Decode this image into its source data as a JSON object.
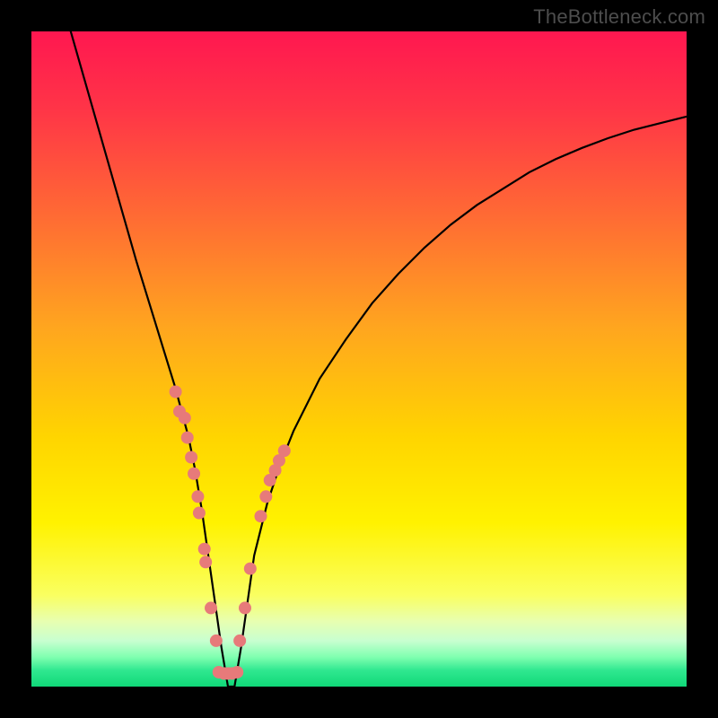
{
  "watermark": {
    "text": "TheBottleneck.com"
  },
  "chart_data": {
    "type": "line",
    "title": "",
    "xlabel": "",
    "ylabel": "",
    "xlim": [
      0,
      100
    ],
    "ylim": [
      0,
      100
    ],
    "gradient_stops": [
      {
        "offset": 0.0,
        "color": "#ff1750"
      },
      {
        "offset": 0.12,
        "color": "#ff3547"
      },
      {
        "offset": 0.28,
        "color": "#ff6a34"
      },
      {
        "offset": 0.45,
        "color": "#ffa51f"
      },
      {
        "offset": 0.62,
        "color": "#ffd500"
      },
      {
        "offset": 0.75,
        "color": "#fff200"
      },
      {
        "offset": 0.86,
        "color": "#faff60"
      },
      {
        "offset": 0.9,
        "color": "#e8ffb0"
      },
      {
        "offset": 0.93,
        "color": "#c8ffd0"
      },
      {
        "offset": 0.955,
        "color": "#80ffb0"
      },
      {
        "offset": 0.975,
        "color": "#30e890"
      },
      {
        "offset": 1.0,
        "color": "#10d878"
      }
    ],
    "series": [
      {
        "name": "bottleneck-curve",
        "x": [
          6,
          8,
          10,
          12,
          14,
          16,
          18,
          20,
          22,
          24,
          25,
          26,
          27,
          28,
          29,
          30,
          31,
          32,
          33,
          34,
          36,
          38,
          40,
          44,
          48,
          52,
          56,
          60,
          64,
          68,
          72,
          76,
          80,
          84,
          88,
          92,
          96,
          100
        ],
        "y": [
          100,
          93,
          86,
          79,
          72,
          65,
          58.5,
          52,
          45.5,
          38,
          33,
          27,
          20,
          13,
          6,
          0,
          0,
          6,
          13,
          20,
          28,
          34,
          39,
          47,
          53,
          58.5,
          63,
          67,
          70.5,
          73.5,
          76,
          78.5,
          80.5,
          82.2,
          83.7,
          85,
          86,
          87
        ]
      }
    ],
    "clusters": [
      {
        "name": "left-cluster",
        "points": [
          {
            "x": 22.0,
            "y": 45.0
          },
          {
            "x": 22.6,
            "y": 42.0
          },
          {
            "x": 23.4,
            "y": 41.0
          },
          {
            "x": 23.8,
            "y": 38.0
          },
          {
            "x": 24.4,
            "y": 35.0
          },
          {
            "x": 24.8,
            "y": 32.5
          },
          {
            "x": 25.4,
            "y": 29.0
          },
          {
            "x": 25.6,
            "y": 26.5
          },
          {
            "x": 26.4,
            "y": 21.0
          },
          {
            "x": 26.6,
            "y": 19.0
          },
          {
            "x": 27.4,
            "y": 12.0
          },
          {
            "x": 28.2,
            "y": 7.0
          }
        ]
      },
      {
        "name": "right-cluster",
        "points": [
          {
            "x": 31.8,
            "y": 7.0
          },
          {
            "x": 32.6,
            "y": 12.0
          },
          {
            "x": 33.4,
            "y": 18.0
          },
          {
            "x": 35.0,
            "y": 26.0
          },
          {
            "x": 35.8,
            "y": 29.0
          },
          {
            "x": 36.4,
            "y": 31.5
          },
          {
            "x": 37.2,
            "y": 33.0
          },
          {
            "x": 37.8,
            "y": 34.5
          },
          {
            "x": 38.6,
            "y": 36.0
          }
        ]
      },
      {
        "name": "bottom-cluster",
        "points": [
          {
            "x": 28.6,
            "y": 2.2
          },
          {
            "x": 29.4,
            "y": 2.0
          },
          {
            "x": 30.0,
            "y": 2.0
          },
          {
            "x": 30.6,
            "y": 2.0
          },
          {
            "x": 31.4,
            "y": 2.2
          }
        ]
      }
    ],
    "marker_color": "#e77a7a",
    "marker_radius_px": 7
  }
}
